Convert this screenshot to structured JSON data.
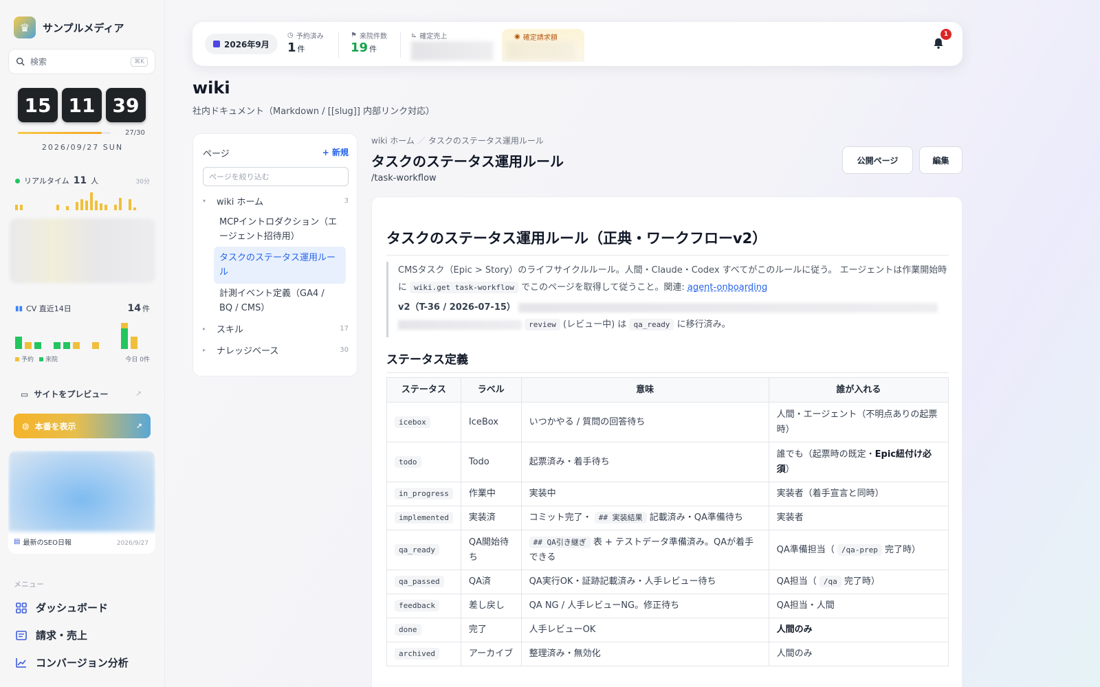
{
  "app": {
    "brand": "サンプルメディア"
  },
  "sidebar": {
    "search_placeholder": "検索",
    "search_shortcut": "⌘K",
    "clock": {
      "hh": "15",
      "mm": "11",
      "ss": "39",
      "day_progress": "27/30",
      "day_progress_fraction": 0.9,
      "date": "2026/09/27 SUN"
    },
    "realtime": {
      "label": "リアルタイム",
      "value": "11",
      "unit": "人",
      "window": "30分"
    },
    "cv": {
      "label": "CV 直近14日",
      "value": "14",
      "unit": "件",
      "legend_reserve": "予約",
      "legend_visit": "来院",
      "today": "今日 0件"
    },
    "preview_label": "サイトをプレビュー",
    "production_label": "本番を表示",
    "seo": {
      "label": "最新のSEO日報",
      "date": "2026/9/27"
    },
    "menu_heading": "メニュー",
    "menu": [
      {
        "label": "ダッシュボード",
        "icon": "grid-icon"
      },
      {
        "label": "請求・売上",
        "icon": "receipt-icon"
      },
      {
        "label": "コンバージョン分析",
        "icon": "chart-icon"
      }
    ]
  },
  "topbar": {
    "month": "2026年9月",
    "reserved": {
      "label": "予約済み",
      "value": "1",
      "unit": "件"
    },
    "visits": {
      "label": "来院件数",
      "value": "19",
      "unit": "件"
    },
    "sales": {
      "label": "確定売上"
    },
    "billing": {
      "label": "確定請求額"
    },
    "notifications": "1"
  },
  "page": {
    "title": "wiki",
    "subtitle": "社内ドキュメント（Markdown / [[slug]] 内部リンク対応）"
  },
  "tree": {
    "heading": "ページ",
    "new_label": "+ 新規",
    "filter_placeholder": "ページを絞り込む",
    "nodes": [
      {
        "label": "wiki ホーム",
        "count": "3",
        "caret": "▾"
      },
      {
        "label": "スキル",
        "count": "17",
        "caret": "▸"
      },
      {
        "label": "ナレッジベース",
        "count": "30",
        "caret": "▸"
      }
    ],
    "children": [
      "MCPイントロダクション（エージェント招待用）",
      "タスクのステータス運用ルール",
      "計測イベント定義（GA4 / BQ / CMS）"
    ]
  },
  "article": {
    "breadcrumb_home": "wiki ホーム",
    "breadcrumb_sep": "／",
    "breadcrumb_current": "タスクのステータス運用ルール",
    "title": "タスクのステータス運用ルール",
    "slug": "/task-workflow",
    "public_button": "公開ページ",
    "edit_button": "編集",
    "h1": "タスクのステータス運用ルール（正典・ワークフローv2）",
    "quote_line1": "CMSタスク（Epic > Story）のライフサイクルルール。人間・Claude・Codex すべてがこのルールに従う。 エージェントは作業開始時に",
    "quote_code": "wiki.get task-workflow",
    "quote_line1b": "でこのページを取得して従うこと。関連:",
    "quote_link": "agent-onboarding",
    "v2_label": "v2（T-36 / 2026-07-15）",
    "v2_code1": "review",
    "v2_text1": "(レビュー中) は",
    "v2_code2": "qa_ready",
    "v2_text2": "に移行済み。",
    "h2": "ステータス定義",
    "table_headers": [
      "ステータス",
      "ラベル",
      "意味",
      "誰が入れる"
    ]
  }
}
